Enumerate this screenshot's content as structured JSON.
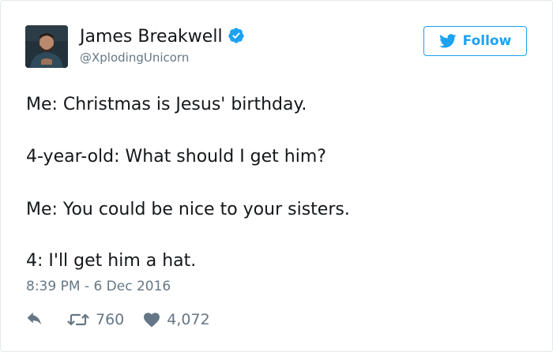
{
  "author": {
    "display_name": "James Breakwell",
    "handle": "@XplodingUnicorn",
    "verified": true,
    "avatar_icon": "avatar-photo"
  },
  "follow_button": {
    "label": "Follow",
    "icon": "twitter-bird-icon"
  },
  "tweet": {
    "lines": [
      "Me: Christmas is Jesus' birthday.",
      "4-year-old: What should I get him?",
      "Me: You could be nice to your sisters.",
      "4: I'll get him a hat."
    ],
    "timestamp": "8:39 PM - 6 Dec 2016"
  },
  "actions": {
    "reply_icon": "reply-icon",
    "retweet_icon": "retweet-icon",
    "retweet_count": "760",
    "like_icon": "heart-icon",
    "like_count": "4,072"
  },
  "colors": {
    "accent": "#1da1f2",
    "text": "#14171a",
    "muted": "#657786",
    "border": "#e1e8ed"
  }
}
